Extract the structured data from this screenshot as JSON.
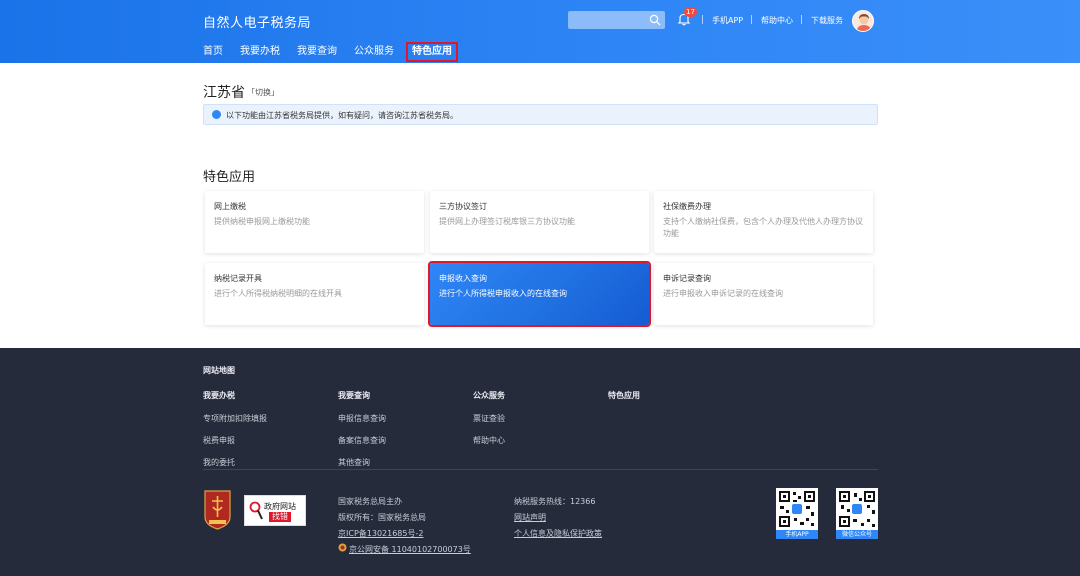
{
  "header": {
    "brand": "自然人电子税务局",
    "nav": [
      "首页",
      "我要办税",
      "我要查询",
      "公众服务",
      "特色应用"
    ],
    "badge_count": "17",
    "links": [
      "手机APP",
      "帮助中心",
      "下载服务"
    ]
  },
  "main": {
    "province": "江苏省",
    "switch_label": "「切换」",
    "notice": "以下功能由江苏省税务局提供，如有疑问，请咨询江苏省税务局。",
    "section_title": "特色应用",
    "cards": [
      {
        "title": "网上缴税",
        "desc": "提供纳税申报网上缴税功能"
      },
      {
        "title": "三方协议签订",
        "desc": "提供网上办理签订税库银三方协议功能"
      },
      {
        "title": "社保缴费办理",
        "desc": "支持个人缴纳社保费，包含个人办理及代他人办理方协议功能"
      },
      {
        "title": "纳税记录开具",
        "desc": "进行个人所得税纳税明细的在线开具"
      },
      {
        "title": "申报收入查询",
        "desc": "进行个人所得税申报收入的在线查询"
      },
      {
        "title": "申诉记录查询",
        "desc": "进行申报收入申诉记录的在线查询"
      }
    ]
  },
  "footer": {
    "sitemap_title": "网站地图",
    "columns": [
      {
        "head": "我要办税",
        "items": [
          "专项附加扣除填报",
          "税费申报",
          "我的委托"
        ]
      },
      {
        "head": "我要查询",
        "items": [
          "申报信息查询",
          "备案信息查询",
          "其他查询"
        ]
      },
      {
        "head": "公众服务",
        "items": [
          "票证查验",
          "帮助中心"
        ]
      },
      {
        "head": "特色应用",
        "items": []
      }
    ],
    "gov_badge": {
      "line1": "政府网站",
      "line2": "找错"
    },
    "info_left": [
      "国家税务总局主办",
      "版权所有：国家税务总局",
      "京ICP备13021685号-2",
      "京公网安备 11040102700073号"
    ],
    "info_right": [
      "纳税服务热线：12366",
      "网站声明",
      "个人信息及隐私保护政策"
    ],
    "qr_labels": [
      "手机APP",
      "微信公众号"
    ]
  }
}
